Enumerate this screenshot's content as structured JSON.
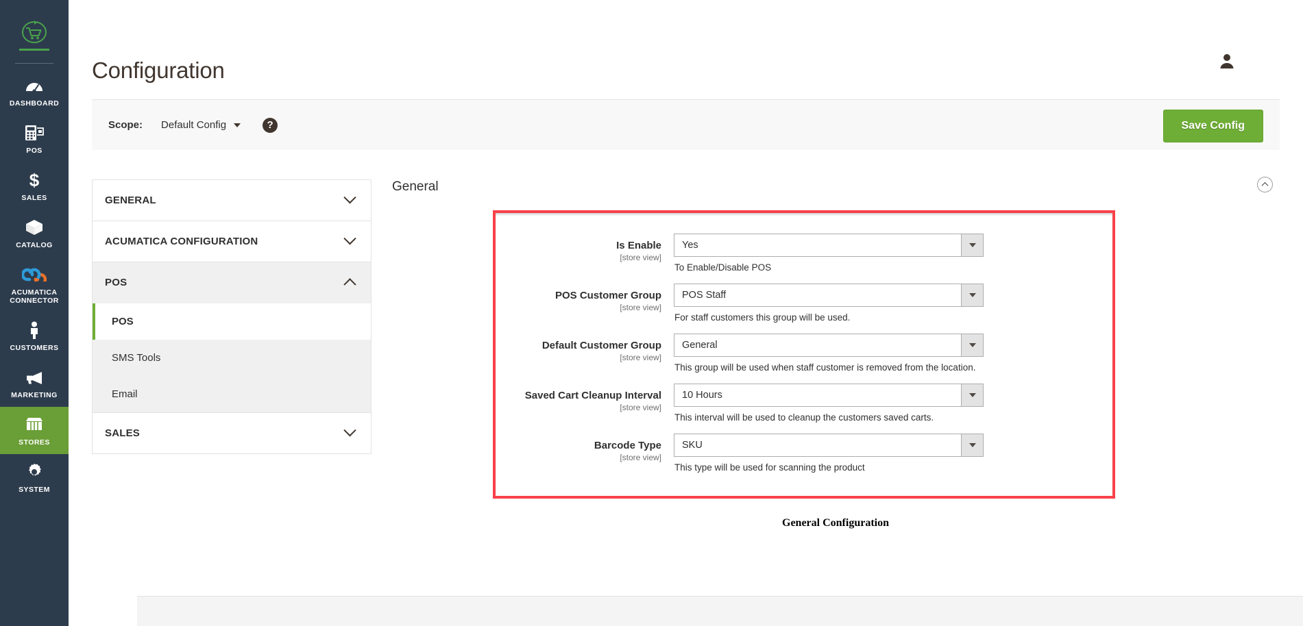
{
  "sidebar": {
    "logo": {
      "icon": "cart-refresh-logo-icon"
    },
    "items": [
      {
        "label": "DASHBOARD",
        "icon": "dashboard-gauge-icon",
        "active": false
      },
      {
        "label": "POS",
        "icon": "pos-terminal-icon",
        "active": false
      },
      {
        "label": "SALES",
        "icon": "dollar-sign-icon",
        "active": false
      },
      {
        "label": "CATALOG",
        "icon": "box-icon",
        "active": false
      },
      {
        "label": "ACUMATICA CONNECTOR",
        "icon": "chain-link-icon",
        "active": false
      },
      {
        "label": "CUSTOMERS",
        "icon": "person-icon",
        "active": false
      },
      {
        "label": "MARKETING",
        "icon": "megaphone-icon",
        "active": false
      },
      {
        "label": "STORES",
        "icon": "storefront-icon",
        "active": true
      },
      {
        "label": "SYSTEM",
        "icon": "gear-icon",
        "active": false
      }
    ]
  },
  "header": {
    "title": "Configuration",
    "user_icon": "user-account-icon"
  },
  "scope_bar": {
    "label": "Scope:",
    "selected": "Default Config",
    "help_icon": "question-mark-icon",
    "save_label": "Save Config"
  },
  "config_nav": {
    "sections": [
      {
        "title": "GENERAL",
        "open": false,
        "items": []
      },
      {
        "title": "ACUMATICA CONFIGURATION",
        "open": false,
        "items": []
      },
      {
        "title": "POS",
        "open": true,
        "items": [
          {
            "label": "POS",
            "current": true
          },
          {
            "label": "SMS Tools",
            "current": false
          },
          {
            "label": "Email",
            "current": false
          }
        ]
      },
      {
        "title": "SALES",
        "open": false,
        "items": []
      }
    ]
  },
  "form": {
    "section_title": "General",
    "collapse_icon": "chevron-up-circle-icon",
    "scope_note": "[store view]",
    "fields": [
      {
        "label": "Is Enable",
        "value": "Yes",
        "note": "To Enable/Disable POS"
      },
      {
        "label": "POS Customer Group",
        "value": "POS Staff",
        "note": "For staff customers this group will be used."
      },
      {
        "label": "Default Customer Group",
        "value": "General",
        "note": "This group will be used when staff customer is removed from the location."
      },
      {
        "label": "Saved Cart Cleanup Interval",
        "value": "10 Hours",
        "note": "This interval will be used to cleanup the customers saved carts."
      },
      {
        "label": "Barcode Type",
        "value": "SKU",
        "note": "This type will be used for scanning the product"
      }
    ]
  },
  "caption": "General Configuration",
  "colors": {
    "sidebar_bg": "#2d3c4d",
    "sidebar_active": "#6a9e36",
    "accent_green": "#6fae36",
    "highlight_red": "#f8414a",
    "logo_green": "#49a34a"
  }
}
